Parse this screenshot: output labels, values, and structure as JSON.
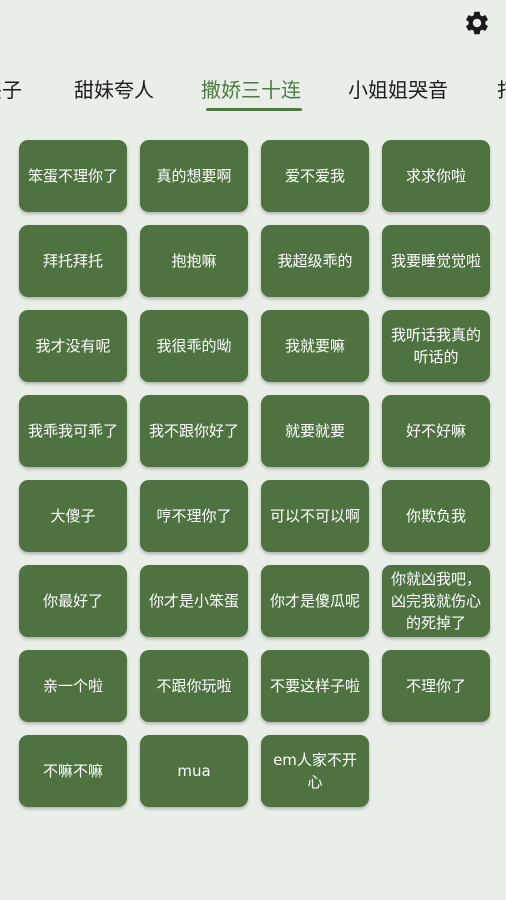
{
  "header": {
    "settings_icon": "gear-icon",
    "tabs": [
      {
        "label": "夹子"
      },
      {
        "label": "甜妹夸人"
      },
      {
        "label": "撒娇三十连"
      },
      {
        "label": "小姐姐哭音"
      },
      {
        "label": "打"
      }
    ],
    "active_tab": "撒娇三十连"
  },
  "colors": {
    "accent": "#4e7a42",
    "button_bg": "#4e7341",
    "background": "#e9efe8"
  },
  "buttons": [
    "笨蛋不理你了",
    "真的想要啊",
    "爱不爱我",
    "求求你啦",
    "拜托拜托",
    "抱抱嘛",
    "我超级乖的",
    "我要睡觉觉啦",
    "我才没有呢",
    "我很乖的呦",
    "我就要嘛",
    "我听话我真的听话的",
    "我乖我可乖了",
    "我不跟你好了",
    "就要就要",
    "好不好嘛",
    "大傻子",
    "哼不理你了",
    "可以不可以啊",
    "你欺负我",
    "你最好了",
    "你才是小笨蛋",
    "你才是傻瓜呢",
    "你就凶我吧，凶完我就伤心的死掉了",
    "亲一个啦",
    "不跟你玩啦",
    "不要这样子啦",
    "不理你了",
    "不嘛不嘛",
    "mua",
    "em人家不开心"
  ]
}
